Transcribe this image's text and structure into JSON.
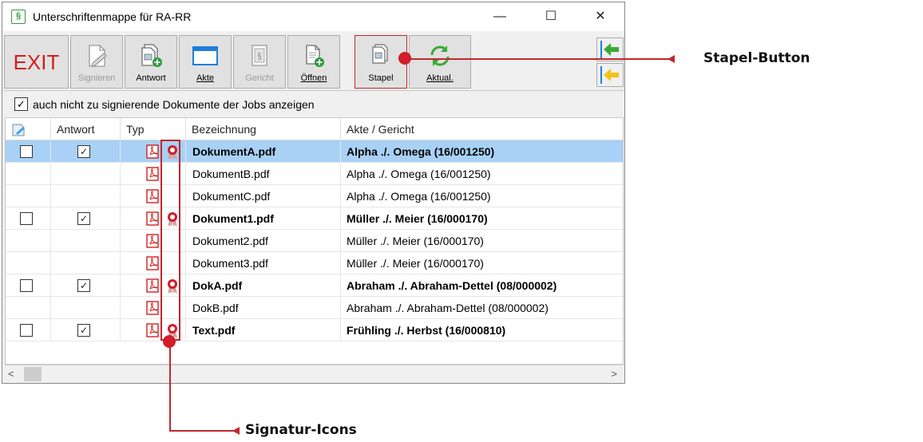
{
  "window": {
    "title": "Unterschriftenmappe für RA-RR",
    "title_icon": "§",
    "controls": {
      "minimize": "—",
      "maximize": "☐",
      "close": "✕"
    }
  },
  "toolbar": {
    "exit_label": "EXIT",
    "buttons": [
      {
        "label": "Signieren",
        "icon": "sign-pen-icon",
        "enabled": false
      },
      {
        "label": "Antwort",
        "icon": "doc-add-icon",
        "enabled": true
      },
      {
        "label": "Akte",
        "icon": "folder-icon",
        "enabled": true
      },
      {
        "label": "Gericht",
        "icon": "court-doc-icon",
        "enabled": false
      },
      {
        "label": "Öffnen",
        "icon": "doc-open-icon",
        "enabled": true
      },
      {
        "label": "Stapel",
        "icon": "stack-add-icon",
        "enabled": true
      },
      {
        "label": "Aktual.",
        "icon": "refresh-icon",
        "enabled": true
      }
    ]
  },
  "filter": {
    "checked": true,
    "label": "auch nicht zu signierende Dokumente der Jobs anzeigen"
  },
  "grid": {
    "columns": [
      "",
      "Antwort",
      "Typ",
      "Bezeichnung",
      "Akte / Gericht"
    ],
    "rows": [
      {
        "selected": true,
        "bold": true,
        "has_checkboxes": true,
        "answer_checked": true,
        "signature": true,
        "name": "DokumentA.pdf",
        "case": "Alpha ./. Omega (16/001250)"
      },
      {
        "selected": false,
        "bold": false,
        "has_checkboxes": false,
        "signature": false,
        "name": "DokumentB.pdf",
        "case": "Alpha ./. Omega (16/001250)"
      },
      {
        "selected": false,
        "bold": false,
        "has_checkboxes": false,
        "signature": false,
        "name": "DokumentC.pdf",
        "case": "Alpha ./. Omega (16/001250)"
      },
      {
        "selected": false,
        "bold": true,
        "has_checkboxes": true,
        "answer_checked": true,
        "signature": true,
        "name": "Dokument1.pdf",
        "case": "Müller ./. Meier (16/000170)"
      },
      {
        "selected": false,
        "bold": false,
        "has_checkboxes": false,
        "signature": false,
        "name": "Dokument2.pdf",
        "case": "Müller ./. Meier (16/000170)"
      },
      {
        "selected": false,
        "bold": false,
        "has_checkboxes": false,
        "signature": false,
        "name": "Dokument3.pdf",
        "case": "Müller ./. Meier (16/000170)"
      },
      {
        "selected": false,
        "bold": true,
        "has_checkboxes": true,
        "answer_checked": true,
        "signature": true,
        "name": "DokA.pdf",
        "case": "Abraham ./. Abraham-Dettel (08/000002)"
      },
      {
        "selected": false,
        "bold": false,
        "has_checkboxes": false,
        "signature": false,
        "name": "DokB.pdf",
        "case": "Abraham ./. Abraham-Dettel (08/000002)"
      },
      {
        "selected": false,
        "bold": true,
        "has_checkboxes": true,
        "answer_checked": true,
        "signature": true,
        "name": "Text.pdf",
        "case": "Frühling ./. Herbst (16/000810)"
      }
    ]
  },
  "scrollbar": {
    "left": "<",
    "right": ">"
  },
  "callouts": {
    "stapel": "Stapel-Button",
    "signatur": "Signatur-Icons"
  },
  "colors": {
    "accent_red": "#c0282c",
    "selection": "#a8d1f5",
    "exit_red": "#d21f1f",
    "icon_green": "#2f9a3e",
    "folder_blue": "#1e7fd8"
  }
}
